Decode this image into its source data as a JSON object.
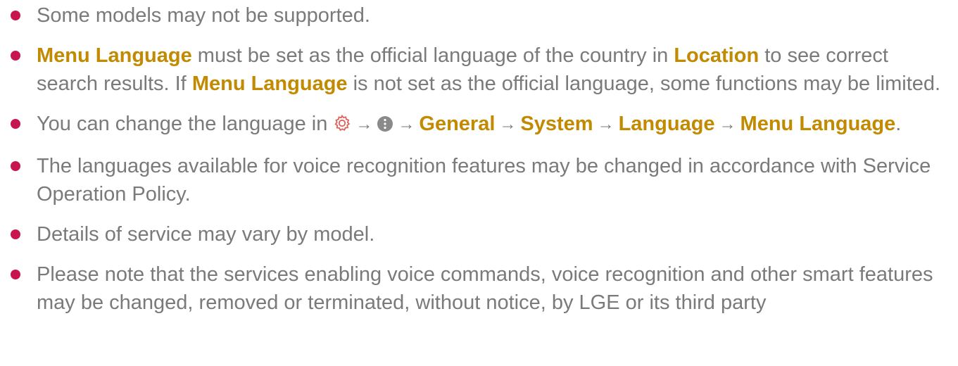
{
  "notes": [
    {
      "segments": [
        {
          "t": "Some models may not be supported."
        }
      ]
    },
    {
      "segments": [
        {
          "t": "Menu Language",
          "hl": true
        },
        {
          "t": " must be set as the official language of the country in "
        },
        {
          "t": "Location",
          "hl": true
        },
        {
          "t": " to see correct search results. If "
        },
        {
          "t": "Menu Language",
          "hl": true
        },
        {
          "t": " is not set as the official language, some functions may be limited."
        }
      ]
    },
    {
      "segments": [
        {
          "t": "You can change the language in "
        },
        {
          "icon": "settings-icon"
        },
        {
          "arrow": "→"
        },
        {
          "icon": "more-options-icon"
        },
        {
          "arrow": "→"
        },
        {
          "t": "General",
          "hl": true
        },
        {
          "arrow": "→"
        },
        {
          "t": "System",
          "hl": true
        },
        {
          "arrow": "→"
        },
        {
          "t": "Language",
          "hl": true
        },
        {
          "arrow": "→"
        },
        {
          "t": "Menu Language",
          "hl": true
        },
        {
          "t": "."
        }
      ]
    },
    {
      "segments": [
        {
          "t": "The languages available for voice recognition features may be changed in accordance with Service Operation Policy."
        }
      ]
    },
    {
      "segments": [
        {
          "t": "Details of service may vary by model."
        }
      ]
    },
    {
      "segments": [
        {
          "t": "Please note that the services enabling voice commands, voice recognition and other smart features may be changed, removed or terminated, without notice, by LGE or its third party"
        }
      ]
    }
  ],
  "colors": {
    "text": "#7a7a7a",
    "highlight": "#c18a00",
    "bullet": "#c8154f",
    "settings_icon": "#e0605a",
    "more_icon": "#8a8a8a"
  }
}
